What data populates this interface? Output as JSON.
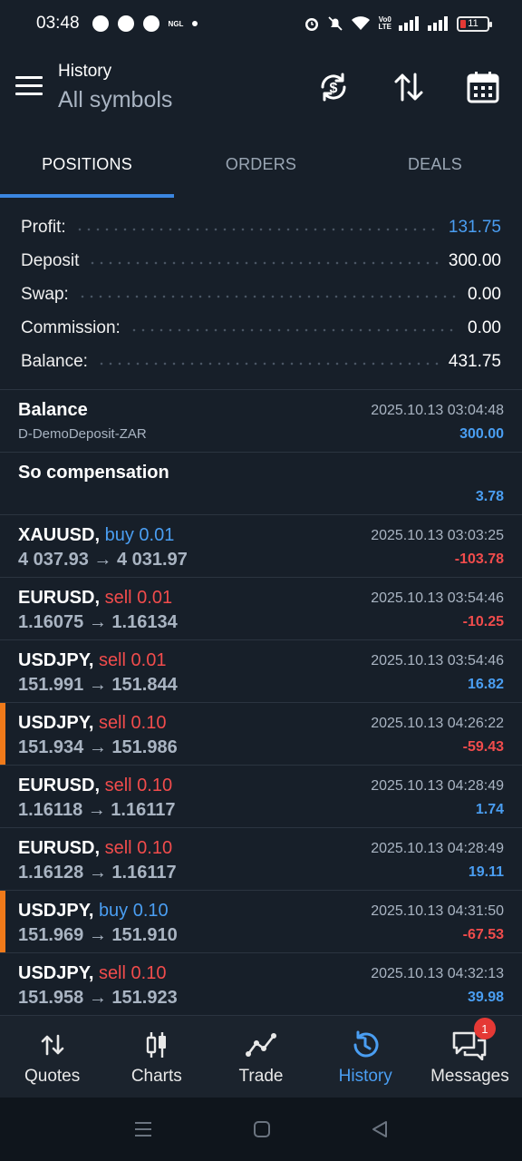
{
  "status_bar": {
    "time": "03:48",
    "battery": "11",
    "volte_line1": "Vo0",
    "volte_line2": "LTE",
    "ngl": "NGL"
  },
  "header": {
    "title": "History",
    "subtitle": "All symbols"
  },
  "tabs": [
    {
      "label": "POSITIONS",
      "active": true
    },
    {
      "label": "ORDERS",
      "active": false
    },
    {
      "label": "DEALS",
      "active": false
    }
  ],
  "summary": [
    {
      "label": "Profit:",
      "value": "131.75",
      "highlight": true
    },
    {
      "label": "Deposit",
      "value": "300.00",
      "highlight": false
    },
    {
      "label": "Swap:",
      "value": "0.00",
      "highlight": false
    },
    {
      "label": "Commission:",
      "value": "0.00",
      "highlight": false
    },
    {
      "label": "Balance:",
      "value": "431.75",
      "highlight": false
    }
  ],
  "rows": [
    {
      "symbol": "Balance",
      "side": "",
      "volume": "",
      "detail": "D-DemoDeposit-ZAR",
      "time": "2025.10.13 03:04:48",
      "pl": "300.00",
      "pl_sign": "pos",
      "marked": false
    },
    {
      "symbol": "So compensation",
      "side": "",
      "volume": "",
      "detail": "",
      "time": "",
      "pl": "3.78",
      "pl_sign": "pos",
      "marked": false
    },
    {
      "symbol": "XAUUSD,",
      "side": "buy",
      "volume": "0.01",
      "detail": "4 037.93 → 4 031.97",
      "time": "2025.10.13 03:03:25",
      "pl": "-103.78",
      "pl_sign": "neg",
      "marked": false
    },
    {
      "symbol": "EURUSD,",
      "side": "sell",
      "volume": "0.01",
      "detail": "1.16075 → 1.16134",
      "time": "2025.10.13 03:54:46",
      "pl": "-10.25",
      "pl_sign": "neg",
      "marked": false
    },
    {
      "symbol": "USDJPY,",
      "side": "sell",
      "volume": "0.01",
      "detail": "151.991 → 151.844",
      "time": "2025.10.13 03:54:46",
      "pl": "16.82",
      "pl_sign": "pos",
      "marked": false
    },
    {
      "symbol": "USDJPY,",
      "side": "sell",
      "volume": "0.10",
      "detail": "151.934 → 151.986",
      "time": "2025.10.13 04:26:22",
      "pl": "-59.43",
      "pl_sign": "neg",
      "marked": true
    },
    {
      "symbol": "EURUSD,",
      "side": "sell",
      "volume": "0.10",
      "detail": "1.16118 → 1.16117",
      "time": "2025.10.13 04:28:49",
      "pl": "1.74",
      "pl_sign": "pos",
      "marked": false
    },
    {
      "symbol": "EURUSD,",
      "side": "sell",
      "volume": "0.10",
      "detail": "1.16128 → 1.16117",
      "time": "2025.10.13 04:28:49",
      "pl": "19.11",
      "pl_sign": "pos",
      "marked": false
    },
    {
      "symbol": "USDJPY,",
      "side": "buy",
      "volume": "0.10",
      "detail": "151.969 → 151.910",
      "time": "2025.10.13 04:31:50",
      "pl": "-67.53",
      "pl_sign": "neg",
      "marked": true
    },
    {
      "symbol": "USDJPY,",
      "side": "sell",
      "volume": "0.10",
      "detail": "151.958 → 151.923",
      "time": "2025.10.13 04:32:13",
      "pl": "39.98",
      "pl_sign": "pos",
      "marked": false
    }
  ],
  "bottom_nav": [
    {
      "label": "Quotes",
      "icon": "quotes-icon",
      "active": false
    },
    {
      "label": "Charts",
      "icon": "charts-icon",
      "active": false
    },
    {
      "label": "Trade",
      "icon": "trade-icon",
      "active": false
    },
    {
      "label": "History",
      "icon": "history-icon",
      "active": true
    },
    {
      "label": "Messages",
      "icon": "messages-icon",
      "active": false,
      "badge": "1"
    }
  ],
  "colors": {
    "background": "#171f29",
    "accent": "#3b86e0",
    "positive": "#4a9ef2",
    "negative": "#f14c4c",
    "marker": "#f07a1a"
  }
}
